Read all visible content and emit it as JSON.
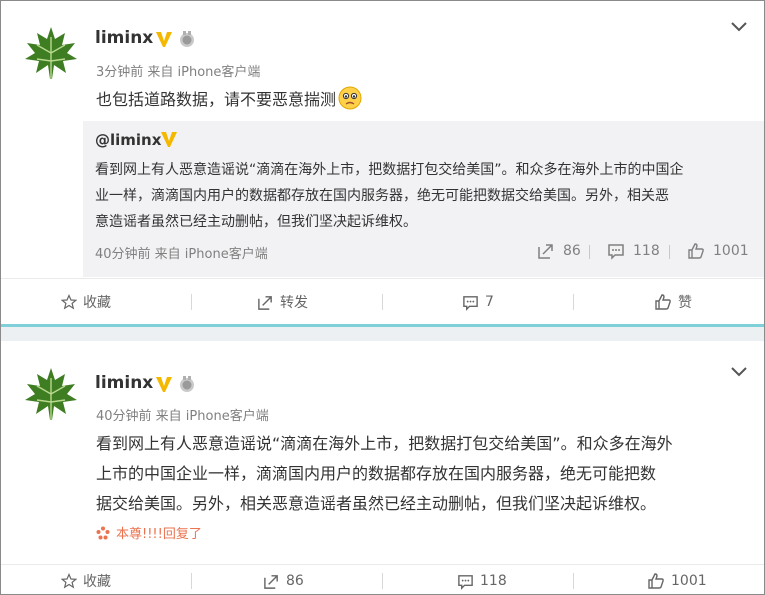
{
  "post1": {
    "author": "liminx",
    "meta": "3分钟前 来自 iPhone客户端",
    "text": "也包括道路数据，请不要恶意揣测",
    "emoji": "sad-face-icon",
    "repost": {
      "author": "@liminx",
      "lines": [
        "看到网上有人恶意造谣说“滴滴在海外上市，把数据打包交给美国”。和众多在海外上市的中国企",
        "业一样，滴滴国内用户的数据都存放在国内服务器，绝无可能把数据交给美国。另外，相关恶",
        "意造谣者虽然已经主动删帖，但我们坚决起诉维权。"
      ],
      "meta": "40分钟前 来自 iPhone客户端",
      "reposts": "86",
      "comments": "118",
      "likes": "1001"
    },
    "actions": {
      "favorite": "收藏",
      "repost": "转发",
      "comments": "7",
      "like": "赞"
    }
  },
  "post2": {
    "author": "liminx",
    "meta": "40分钟前 来自 iPhone客户端",
    "lines": [
      "看到网上有人恶意造谣说“滴滴在海外上市，把数据打包交给美国”。和众多在海外",
      "上市的中国企业一样，滴滴国内用户的数据都存放在国内服务器，绝无可能把数",
      "据交给美国。另外，相关恶意造谣者虽然已经主动删帖，但我们坚决起诉维权。"
    ],
    "reply_note": "本尊!!!!回复了",
    "actions": {
      "favorite": "收藏",
      "reposts": "86",
      "comments": "118",
      "likes": "1001"
    }
  },
  "colors": {
    "accent_orange": "#eb7350",
    "verified_gold": "#f5b800",
    "separator": "#edf0f3",
    "teal_line": "#7fd0d8"
  }
}
